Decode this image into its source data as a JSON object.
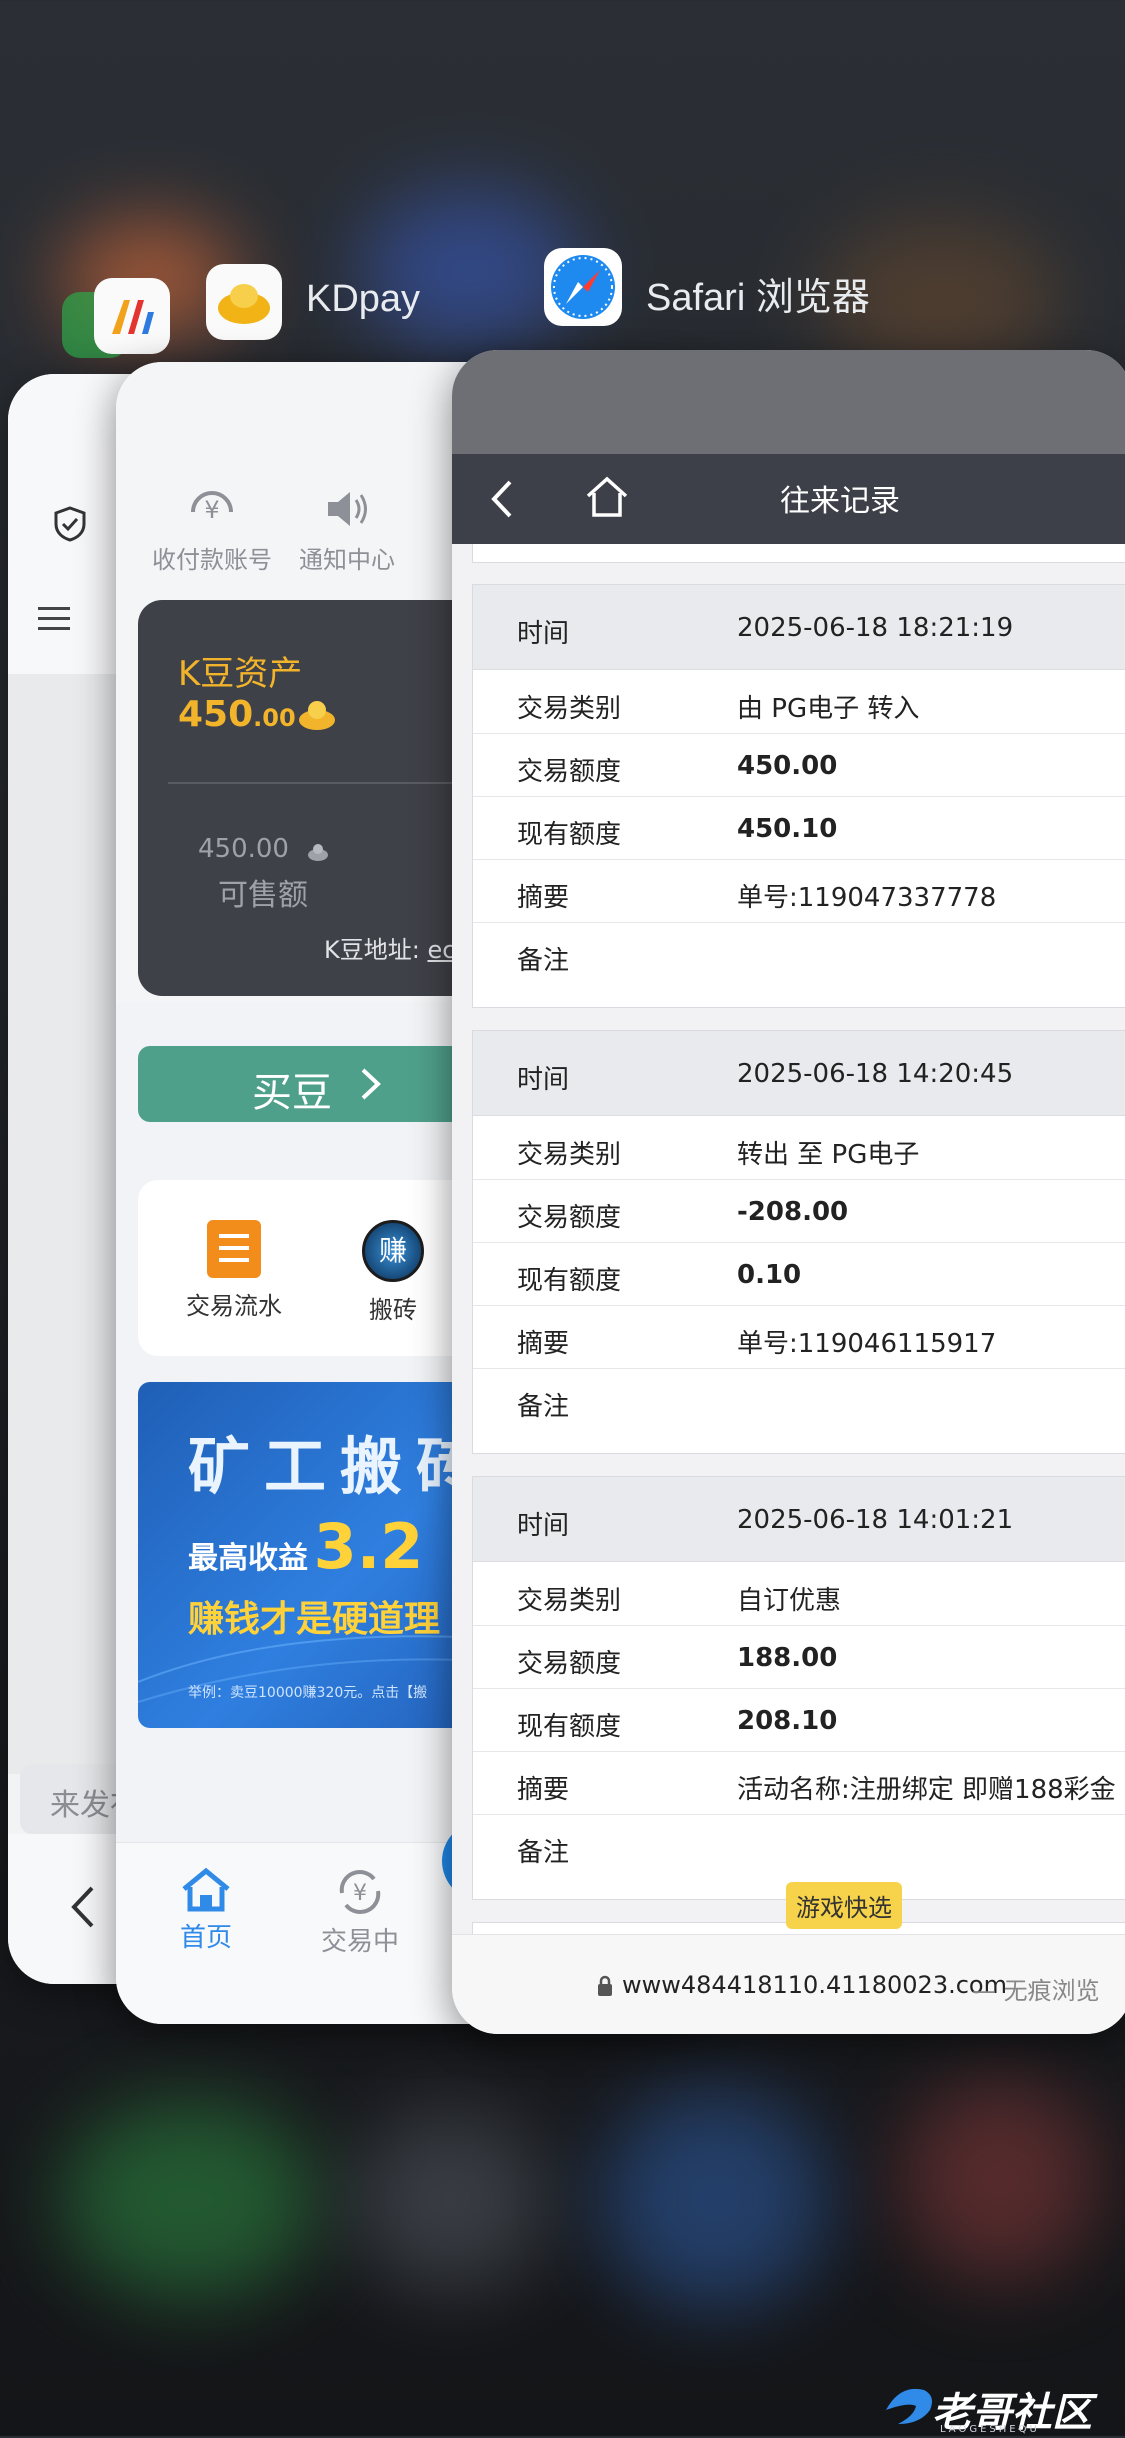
{
  "switcher": {
    "apps": [
      {
        "name": ""
      },
      {
        "name": "KDpay"
      },
      {
        "name": "Safari 浏览器"
      }
    ]
  },
  "kdpay": {
    "top_icons": [
      {
        "label": "收付款账号",
        "icon": "yen-icon"
      },
      {
        "label": "通知中心",
        "icon": "speaker-icon"
      }
    ],
    "asset_title": "K豆资产",
    "asset_amount_int": "450",
    "asset_amount_dec": ".00",
    "available_amount": "450.00",
    "available_label": "可售额",
    "address_label": "K豆地址:",
    "address_value": "ec",
    "buy_label": "买豆",
    "grid_items": [
      {
        "label": "交易流水",
        "icon": "list-icon"
      },
      {
        "label": "搬砖",
        "icon": "earn-icon",
        "icon_text": "赚"
      }
    ],
    "banner": {
      "title": "矿工搬砖",
      "subtitle_prefix": "最高收益",
      "subtitle_value": "3.2",
      "tagline": "赚钱才是硬道理",
      "footnote": "举例：卖豆10000赚320元。点击【搬"
    },
    "tabbar": [
      {
        "label": "首页",
        "active": true
      },
      {
        "label": "交易中",
        "active": false
      }
    ]
  },
  "chat_card": {
    "input_placeholder": "来发布"
  },
  "safari": {
    "page_title": "往来记录",
    "records": [
      {
        "time_label": "时间",
        "time": "2025-06-18 18:21:19",
        "rows": [
          {
            "key": "交易类别",
            "value": "由 PG电子 转入",
            "bold": false
          },
          {
            "key": "交易额度",
            "value": "450.00",
            "bold": true
          },
          {
            "key": "现有额度",
            "value": "450.10",
            "bold": true
          },
          {
            "key": "摘要",
            "value": "单号:119047337778",
            "bold": false
          },
          {
            "key": "备注",
            "value": "",
            "bold": false
          }
        ]
      },
      {
        "time_label": "时间",
        "time": "2025-06-18 14:20:45",
        "rows": [
          {
            "key": "交易类别",
            "value": "转出 至 PG电子",
            "bold": false
          },
          {
            "key": "交易额度",
            "value": "-208.00",
            "bold": true
          },
          {
            "key": "现有额度",
            "value": "0.10",
            "bold": true
          },
          {
            "key": "摘要",
            "value": "单号:119046115917",
            "bold": false
          },
          {
            "key": "备注",
            "value": "",
            "bold": false
          }
        ]
      },
      {
        "time_label": "时间",
        "time": "2025-06-18 14:01:21",
        "rows": [
          {
            "key": "交易类别",
            "value": "自订优惠",
            "bold": false
          },
          {
            "key": "交易额度",
            "value": "188.00",
            "bold": true
          },
          {
            "key": "现有额度",
            "value": "208.10",
            "bold": true
          },
          {
            "key": "摘要",
            "value": "活动名称:注册绑定 即赠188彩金",
            "bold": false
          },
          {
            "key": "备注",
            "value": "",
            "bold": false
          }
        ]
      }
    ],
    "floating_badge": "游戏快选",
    "url": "www484418110.41180023.com",
    "url_suffix": "— 无痕浏览"
  },
  "watermark": {
    "text": "老哥社区",
    "subtext": "LAOGESHEQU"
  },
  "colors": {
    "navbar": "#3e4049",
    "buy_button": "#4fa08b",
    "gold": "#f2b42a",
    "tab_active": "#2f8ae8"
  }
}
